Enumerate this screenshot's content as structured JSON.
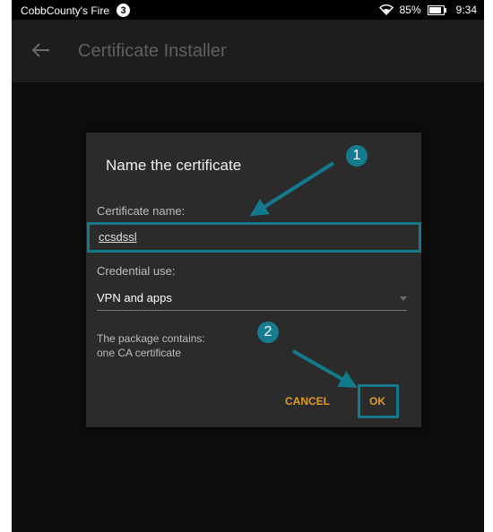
{
  "status_bar": {
    "device_name": "CobbCounty's Fire",
    "notification_count": "3",
    "battery_percent": "85%",
    "battery_level": 0.85,
    "time": "9:34",
    "icons": [
      "wifi-icon",
      "battery-icon"
    ]
  },
  "app_bar": {
    "title": "Certificate Installer",
    "back_icon": "back-arrow-icon"
  },
  "dialog": {
    "title": "Name the certificate",
    "certificate_name_label": "Certificate name:",
    "certificate_name_value": "ccsdssl",
    "credential_use_label": "Credential use:",
    "credential_use_value": "VPN and apps",
    "package_line1": "The package contains:",
    "package_line2": "one CA certificate",
    "cancel_label": "CANCEL",
    "ok_label": "OK"
  },
  "annotations": {
    "step1": "1",
    "step2": "2"
  },
  "colors": {
    "annotation": "#137a8e",
    "button_text": "#e49a1c",
    "dialog_bg": "#2b2b2b",
    "app_bar_bg": "#1d1d1d"
  }
}
